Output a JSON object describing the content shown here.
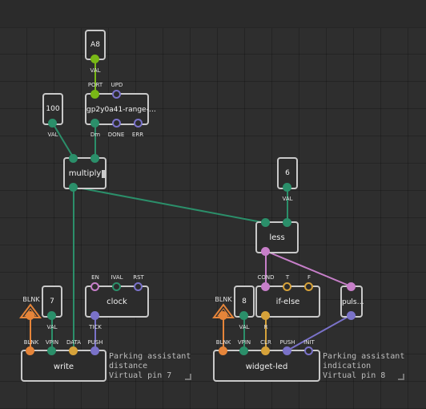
{
  "nodes": {
    "a8": {
      "value": "A8",
      "pin": "VAL"
    },
    "sensor": {
      "title": "gp2y0a41-range-…",
      "inputs": [
        "PORT",
        "UPD"
      ],
      "outputs": [
        "Dm",
        "DONE",
        "ERR"
      ]
    },
    "c100": {
      "value": "100",
      "pin": "VAL"
    },
    "multiply": {
      "title": "multiply"
    },
    "c6": {
      "value": "6",
      "pin": "VAL"
    },
    "less": {
      "title": "less"
    },
    "clock": {
      "title": "clock",
      "inputs": [
        "EN",
        "IVAL",
        "RST"
      ],
      "outputs": [
        "TICK"
      ]
    },
    "blnk1": {
      "title": "BLNK"
    },
    "c7": {
      "value": "7",
      "pin": "VAL"
    },
    "write": {
      "title": "write",
      "inputs": [
        "BLNK",
        "VPIN",
        "DATA",
        "PUSH"
      ]
    },
    "blnk2": {
      "title": "BLNK"
    },
    "c8": {
      "value": "8",
      "pin": "VAL"
    },
    "ifelse": {
      "title": "if-else",
      "inputs": [
        "COND",
        "T",
        "F"
      ],
      "outputs": [
        "R"
      ]
    },
    "pulse": {
      "title": "puls…"
    },
    "widget_led": {
      "title": "widget-led",
      "inputs": [
        "BLNK",
        "VPIN",
        "CLR",
        "PUSH",
        "INIT"
      ]
    }
  },
  "comments": [
    {
      "lines": [
        "Parking assistant",
        "distance",
        "Virtual pin 7"
      ]
    },
    {
      "lines": [
        "Parking assistant",
        "indication",
        "Virtual pin 8"
      ]
    }
  ],
  "colors": {
    "number_link": "#2b8f6a",
    "port_link": "#79b817",
    "boolean_link": "#c77fc9",
    "pulse_link": "#7a72c9",
    "string_link": "#d6a23a",
    "blink_link": "#e6853a",
    "node_border": "#c9c9c9",
    "background": "#2e2e2e"
  }
}
